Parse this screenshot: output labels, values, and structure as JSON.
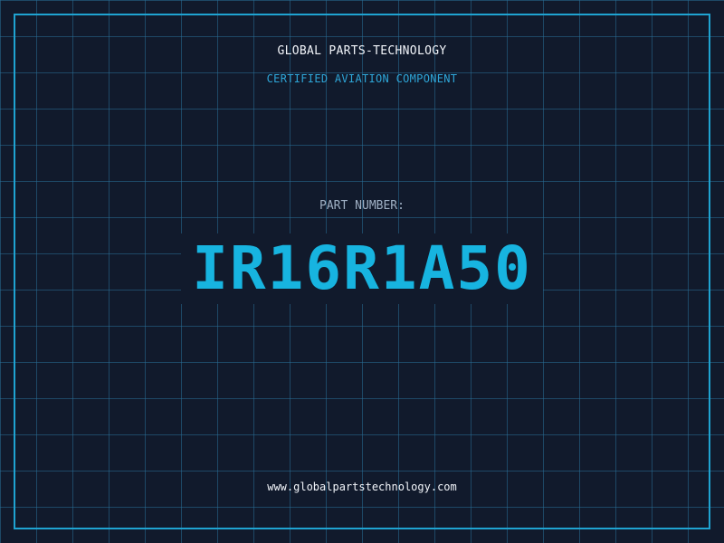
{
  "header": {
    "company": "GLOBAL PARTS-TECHNOLOGY",
    "tagline": "CERTIFIED AVIATION COMPONENT"
  },
  "part": {
    "label": "PART NUMBER:",
    "number": "IR16R1A50"
  },
  "footer": {
    "url": "www.globalpartstechnology.com"
  },
  "colors": {
    "background": "#111a2c",
    "grid": "#286e96",
    "accent": "#1fa3d1",
    "part_number": "#17b4e0",
    "text": "#f2f5fa",
    "label": "#9fb0c4"
  }
}
